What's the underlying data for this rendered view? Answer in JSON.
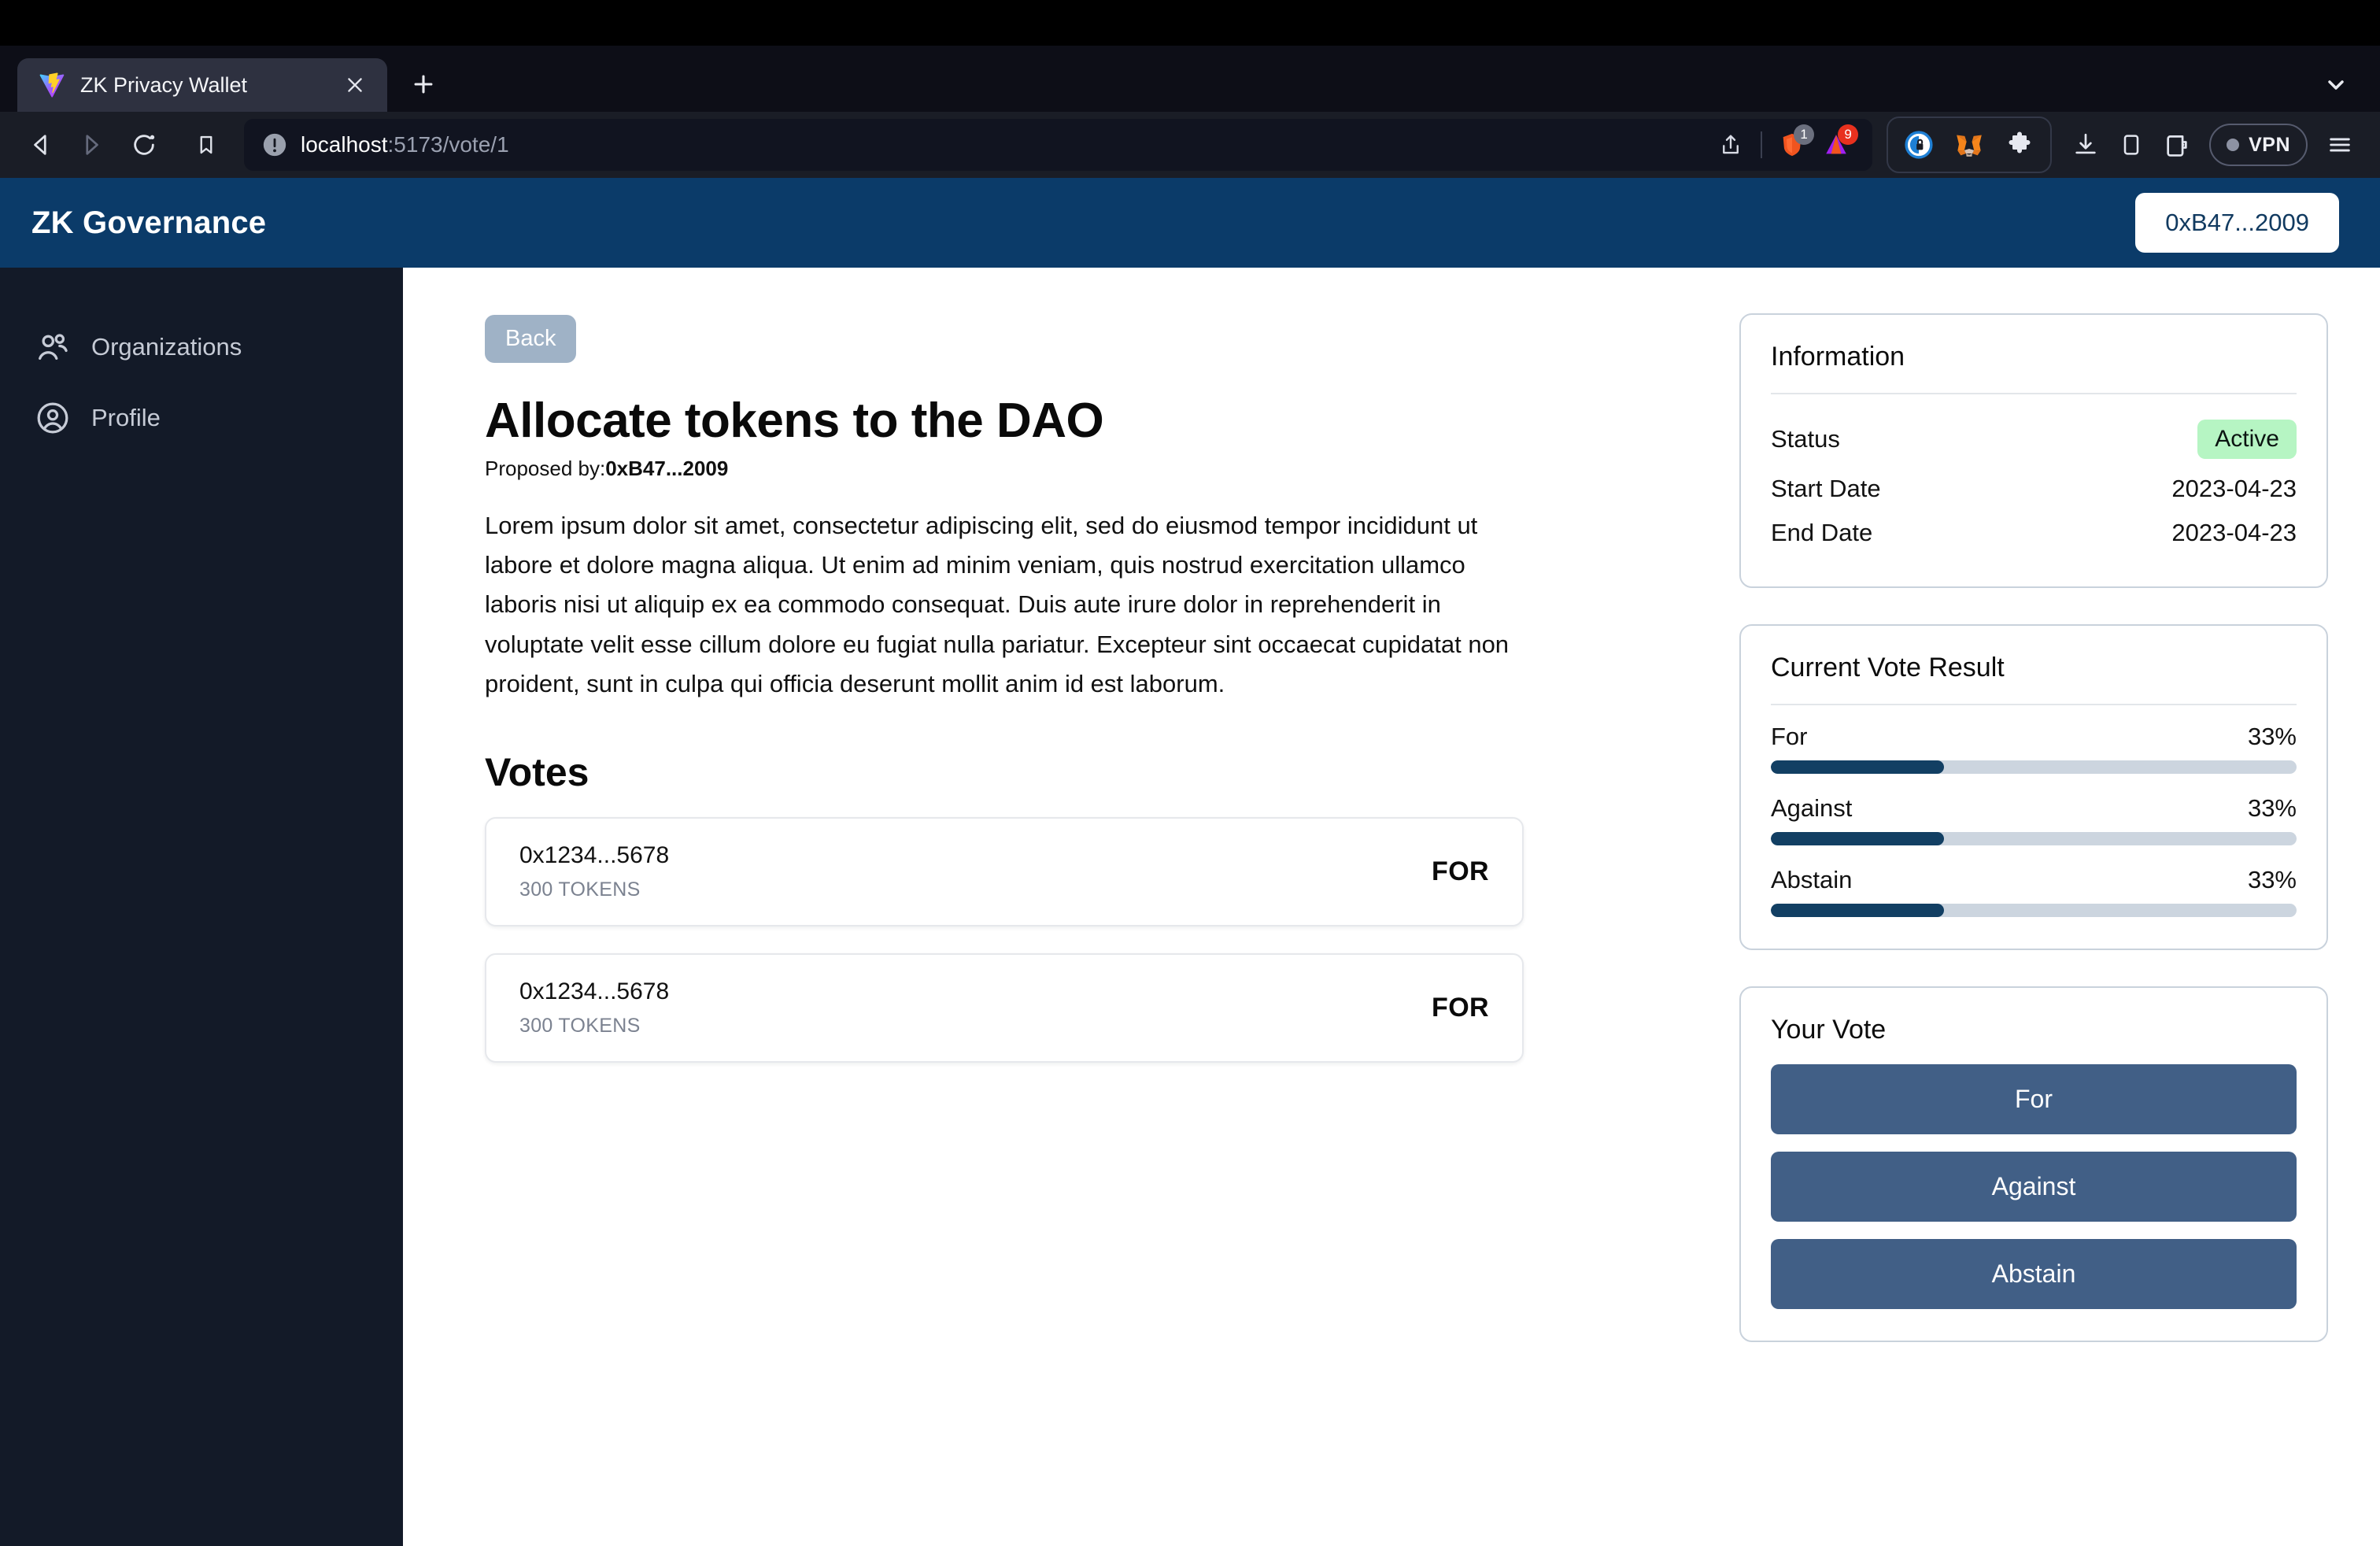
{
  "browser": {
    "tab": {
      "title": "ZK Privacy Wallet",
      "favicon_name": "vite-logo-icon",
      "close_label": "×"
    },
    "new_tab_label": "+",
    "tab_search_name": "chevron-down-icon",
    "nav": {
      "back_name": "back-arrow-icon",
      "forward_name": "forward-arrow-icon",
      "reload_name": "reload-icon",
      "bookmark_name": "bookmark-icon"
    },
    "url": {
      "host": "localhost",
      "path": ":5173/vote/1",
      "full": "localhost:5173/vote/1",
      "info_icon_name": "not-secure-info-icon"
    },
    "url_actions": [
      {
        "name": "share-icon",
        "badge": null
      },
      {
        "name": "brave-shields-icon",
        "badge": "1"
      },
      {
        "name": "brave-rewards-icon",
        "badge": "9"
      }
    ],
    "extensions": [
      {
        "name": "privacy-badger-extension-icon"
      },
      {
        "name": "metamask-extension-icon"
      },
      {
        "name": "extensions-puzzle-icon"
      }
    ],
    "toolbar_icons": [
      {
        "name": "downloads-icon"
      },
      {
        "name": "sidebar-toggle-icon"
      },
      {
        "name": "brave-wallet-icon"
      }
    ],
    "vpn": {
      "label": "VPN"
    },
    "menu_name": "hamburger-menu-icon"
  },
  "app": {
    "header": {
      "brand": "ZK Governance",
      "wallet_address": "0xB47...2009"
    },
    "sidebar": {
      "items": [
        {
          "label": "Organizations",
          "icon": "users-icon"
        },
        {
          "label": "Profile",
          "icon": "user-circle-icon"
        }
      ]
    },
    "main": {
      "back_label": "Back",
      "proposal_title": "Allocate tokens to the DAO",
      "proposed_by_label": "Proposed by:",
      "proposed_by_address": "0xB47...2009",
      "description": "Lorem ipsum dolor sit amet, consectetur adipiscing elit, sed do eiusmod tempor incididunt ut labore et dolore magna aliqua. Ut enim ad minim veniam, quis nostrud exercitation ullamco laboris nisi ut aliquip ex ea commodo consequat. Duis aute irure dolor in reprehenderit in voluptate velit esse cillum dolore eu fugiat nulla pariatur. Excepteur sint occaecat cupidatat non proident, sunt in culpa qui officia deserunt mollit anim id est laborum.",
      "votes_heading": "Votes",
      "votes": [
        {
          "voter": "0x1234...5678",
          "tokens": "300 TOKENS",
          "choice": "FOR"
        },
        {
          "voter": "0x1234...5678",
          "tokens": "300 TOKENS",
          "choice": "FOR"
        }
      ]
    },
    "aside": {
      "information": {
        "title": "Information",
        "status_label": "Status",
        "status_value": "Active",
        "start_label": "Start Date",
        "start_value": "2023-04-23",
        "end_label": "End Date",
        "end_value": "2023-04-23"
      },
      "results": {
        "title": "Current Vote Result",
        "rows": [
          {
            "label": "For",
            "pct_text": "33%",
            "pct": 33
          },
          {
            "label": "Against",
            "pct_text": "33%",
            "pct": 33
          },
          {
            "label": "Abstain",
            "pct_text": "33%",
            "pct": 33
          }
        ]
      },
      "your_vote": {
        "title": "Your Vote",
        "buttons": [
          {
            "label": "For"
          },
          {
            "label": "Against"
          },
          {
            "label": "Abstain"
          }
        ]
      }
    }
  },
  "colors": {
    "header_blue": "#0b3b69",
    "sidebar_navy": "#131a28",
    "bar_fill": "#123f63",
    "bar_track": "#ccd5df",
    "vote_button": "#415f86",
    "status_green": "#b6f5c3",
    "back_button": "#9fb2c6"
  }
}
